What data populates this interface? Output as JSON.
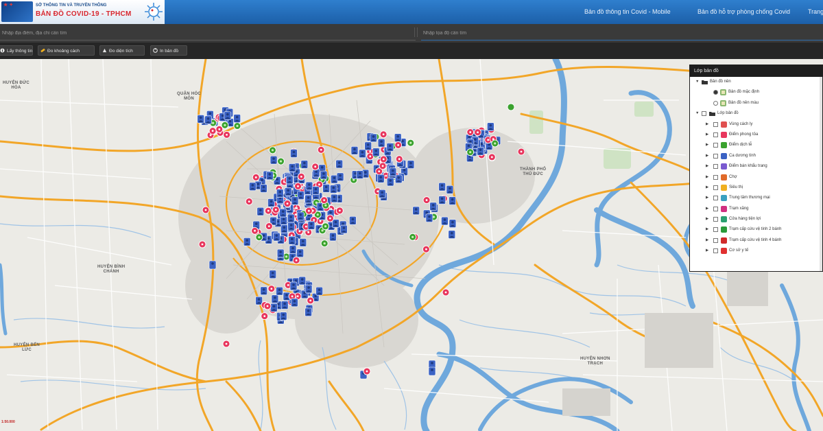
{
  "header": {
    "org_name": "SỞ THÔNG TIN VÀ TRUYỀN THÔNG",
    "app_name": "BẢN ĐỒ COVID-19 - TPHCM",
    "nav": [
      {
        "label": "Bản đồ thông tin Covid - Mobile"
      },
      {
        "label": "Bản đồ hỗ trợ phòng chống Covid"
      },
      {
        "label": "Trang"
      }
    ]
  },
  "search": {
    "place_placeholder": "Nhập địa điểm, địa chỉ cần tìm",
    "coord_placeholder": "Nhập tọa độ cần tìm"
  },
  "toolbar": {
    "buttons": [
      {
        "label": "Lấy thông tin"
      },
      {
        "label": "Đo khoảng cách"
      },
      {
        "label": "Đo diện tích"
      },
      {
        "label": "In bản đồ"
      }
    ]
  },
  "map": {
    "places": [
      {
        "label": "HUYỆN ĐỨC\nHÒA"
      },
      {
        "label": "QUẬN HÓC\nMÔN"
      },
      {
        "label": "HUYỆN BÌNH\nCHÁNH"
      },
      {
        "label": "HUYỆN BẾN\nLỨC"
      },
      {
        "label": "THÀNH PHỐ\nTHỦ ĐỨC"
      },
      {
        "label": "HUYỆN NHƠN\nTRẠCH"
      }
    ],
    "scale_label": "1:50.000"
  },
  "layer_panel": {
    "title": "Lớp bản đồ",
    "groups": [
      {
        "label": "Bản đồ nền",
        "items": [
          {
            "label": "Bản đồ mặc định"
          },
          {
            "label": "Bản đồ nền màu"
          }
        ]
      },
      {
        "label": "Lớp bản đồ",
        "items": [
          {
            "label": "Vùng cách ly",
            "color": "#e05050"
          },
          {
            "label": "Điểm phong tỏa",
            "color": "#e8365d"
          },
          {
            "label": "Điểm dịch tễ",
            "color": "#3ba22f"
          },
          {
            "label": "Ca dương tính",
            "color": "#3b62c4"
          },
          {
            "label": "Điểm bán khẩu trang",
            "color": "#7a5ad0"
          },
          {
            "label": "Chợ",
            "color": "#e06a2a"
          },
          {
            "label": "Siêu thị",
            "color": "#f0b020"
          },
          {
            "label": "Trung tâm thương mại",
            "color": "#3aa0c0"
          },
          {
            "label": "Trạm xăng",
            "color": "#d03080"
          },
          {
            "label": "Cửa hàng tiện lợi",
            "color": "#2aa070"
          },
          {
            "label": "Trạm cấp cứu vệ tinh 2 bánh",
            "color": "#2a9a3a"
          },
          {
            "label": "Trạm cấp cứu vệ tinh 4 bánh",
            "color": "#d02a2a"
          },
          {
            "label": "Cơ sở y tế",
            "color": "#e03030"
          }
        ]
      }
    ]
  },
  "colors": {
    "header_blue": "#1c5fa8",
    "case_marker": "#3b62c4",
    "lockdown_marker": "#e8365d",
    "epidemic_marker": "#3ba22f",
    "river": "#6fa8dc",
    "major_road": "#f2a628"
  },
  "icons": [
    "virus-icon",
    "info-icon",
    "ruler-icon",
    "area-icon",
    "printer-icon",
    "folder-icon",
    "person-marker-icon",
    "lockdown-marker-icon",
    "epidemic-marker-icon"
  ]
}
